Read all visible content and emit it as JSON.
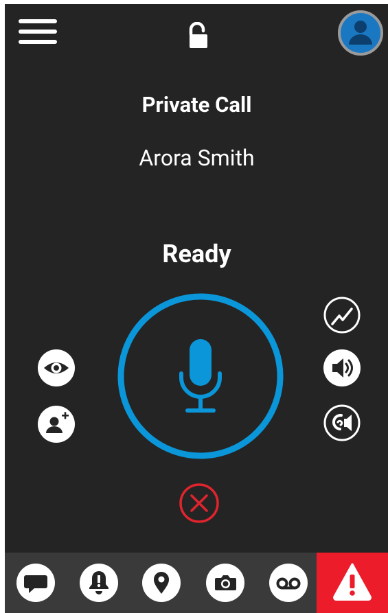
{
  "header": {
    "menu_icon": "hamburger-menu-icon",
    "lock_icon": "unlocked-padlock-icon",
    "avatar_icon": "user-avatar-icon"
  },
  "call": {
    "type": "Private Call",
    "contact": "Arora Smith",
    "status": "Ready"
  },
  "colors": {
    "background": "#242424",
    "accent": "#0a96d8",
    "danger": "#e0242e",
    "emergency": "#ec1c2b",
    "bottom_bar": "#3a3a3a"
  },
  "left_controls": [
    {
      "icon": "eye-icon"
    },
    {
      "icon": "add-user-icon"
    }
  ],
  "right_controls": [
    {
      "icon": "signal-graph-icon"
    },
    {
      "icon": "speaker-icon"
    },
    {
      "icon": "earpiece-icon"
    }
  ],
  "bottom_bar": [
    {
      "icon": "chat-icon"
    },
    {
      "icon": "alert-bell-icon"
    },
    {
      "icon": "location-pin-icon"
    },
    {
      "icon": "camera-icon"
    },
    {
      "icon": "voicemail-icon"
    },
    {
      "icon": "emergency-warning-icon"
    }
  ]
}
